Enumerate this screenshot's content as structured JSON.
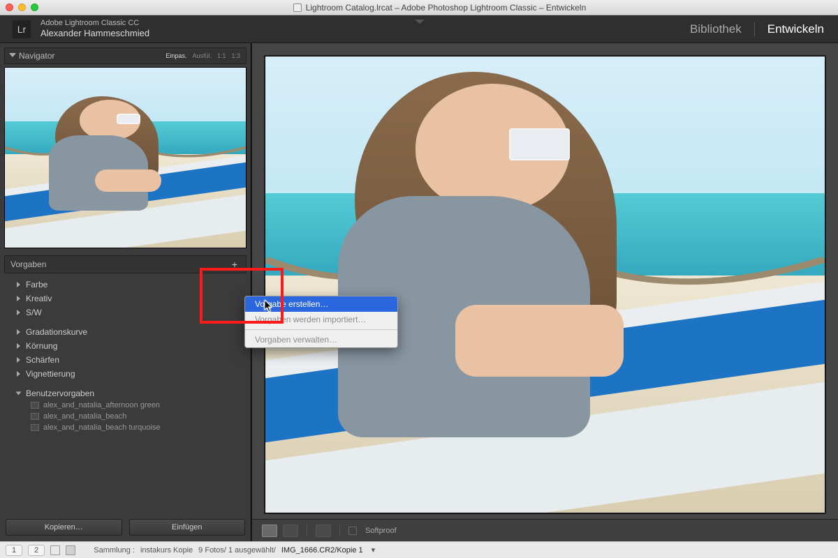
{
  "titlebar": {
    "title": "Lightroom Catalog.lrcat – Adobe Photoshop Lightroom Classic – Entwickeln"
  },
  "idbar": {
    "product": "Adobe Lightroom Classic CC",
    "user": "Alexander Hammeschmied",
    "modules": {
      "library": "Bibliothek",
      "develop": "Entwickeln"
    }
  },
  "navigator": {
    "title": "Navigator",
    "zoom_levels": {
      "fit": "Einpas.",
      "fill": "Ausfül.",
      "one": "1:1",
      "ratio": "1:3"
    }
  },
  "presets": {
    "title": "Vorgaben",
    "groups": [
      {
        "label": "Farbe"
      },
      {
        "label": "Kreativ"
      },
      {
        "label": "S/W"
      }
    ],
    "groups2": [
      {
        "label": "Gradationskurve"
      },
      {
        "label": "Körnung"
      },
      {
        "label": "Schärfen"
      },
      {
        "label": "Vignettierung"
      }
    ],
    "user_group": "Benutzervorgaben",
    "user_items": [
      "alex_and_natalia_afternoon green",
      "alex_and_natalia_beach",
      "alex_and_natalia_beach turquoise"
    ]
  },
  "popup": {
    "create": "Vorgabe erstellen…",
    "import": "Vorgaben werden importiert…",
    "manage": "Vorgaben verwalten…"
  },
  "leftbuttons": {
    "copy": "Kopieren…",
    "paste": "Einfügen"
  },
  "toolbar": {
    "softproof": "Softproof"
  },
  "statusbar": {
    "page1": "1",
    "page2": "2",
    "collection_label": "Sammlung :",
    "collection_name": "instakurs Kopie",
    "count": "9 Fotos/ 1 ausgewählt/",
    "filename": "IMG_1666.CR2/Kopie 1"
  }
}
